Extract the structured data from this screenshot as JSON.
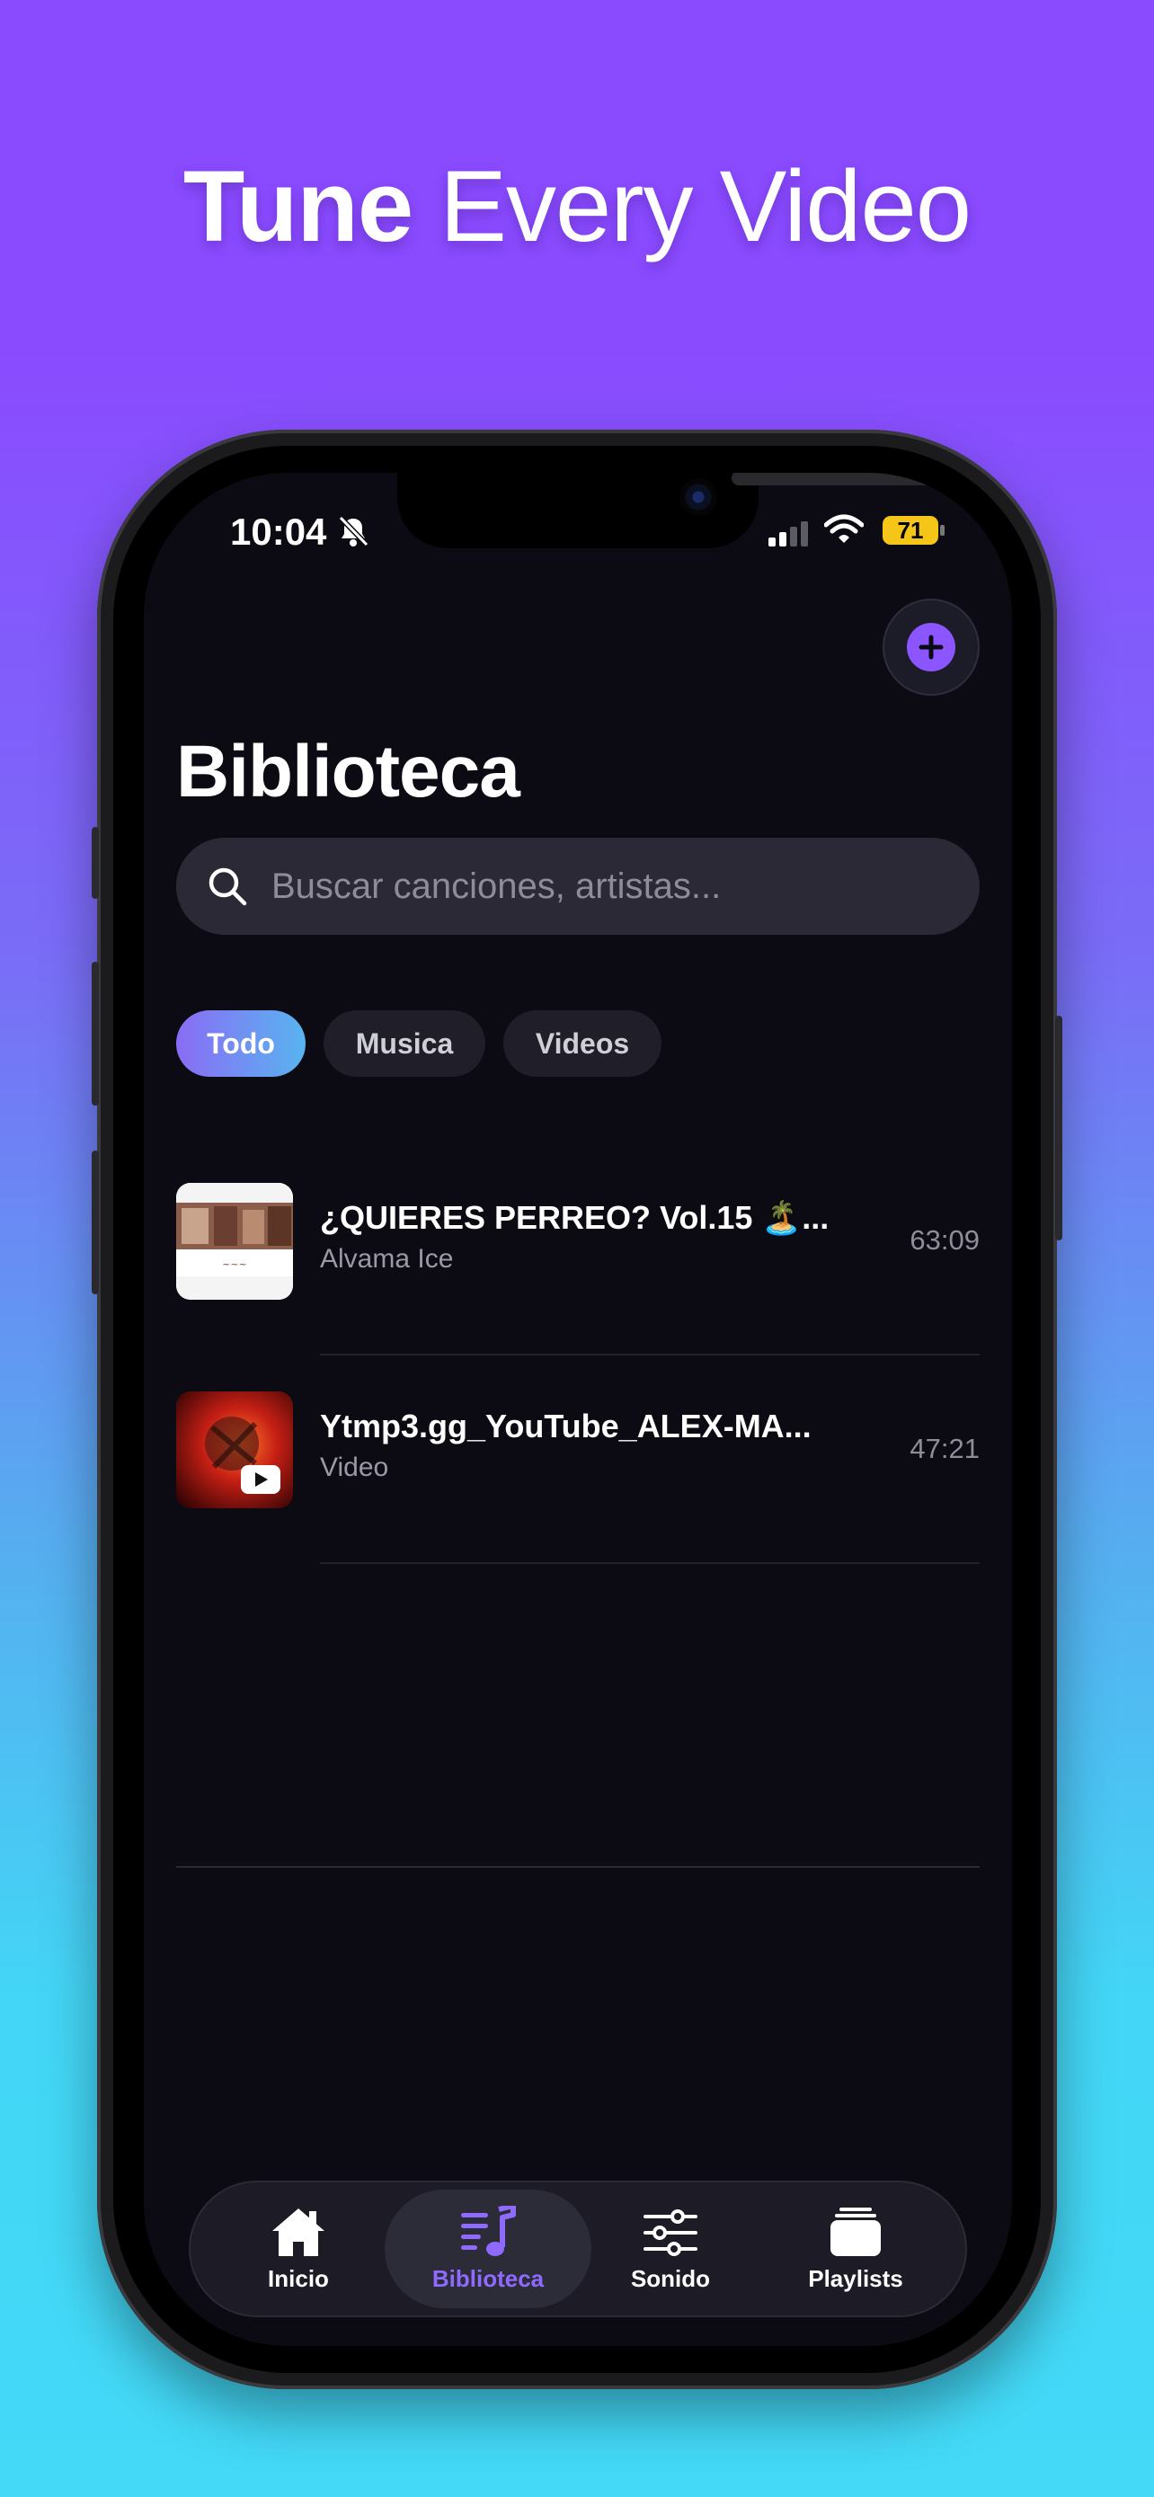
{
  "headline": {
    "bold": "Tune",
    "regular": "Every Video"
  },
  "status_bar": {
    "time": "10:04",
    "battery": "71"
  },
  "header": {
    "title": "Biblioteca"
  },
  "search": {
    "placeholder": "Buscar canciones, artistas..."
  },
  "filters": {
    "active": "Todo",
    "items": [
      "Todo",
      "Musica",
      "Videos"
    ]
  },
  "tracks": [
    {
      "title": "¿QUIERES PERREO? Vol.15 🏝️...",
      "subtitle": "Alvama Ice",
      "duration": "63:09"
    },
    {
      "title": "Ytmp3.gg_YouTube_ALEX-MA...",
      "subtitle": "Video",
      "duration": "47:21"
    }
  ],
  "tabbar": {
    "active": "Biblioteca",
    "items": [
      {
        "label": "Inicio",
        "icon": "home-icon"
      },
      {
        "label": "Biblioteca",
        "icon": "music-library-icon"
      },
      {
        "label": "Sonido",
        "icon": "equalizer-sliders-icon"
      },
      {
        "label": "Playlists",
        "icon": "stacked-playlists-icon"
      }
    ]
  },
  "colors": {
    "accent": "#8b55ff",
    "screen_bg": "#0c0b13",
    "battery": "#f5c518"
  }
}
